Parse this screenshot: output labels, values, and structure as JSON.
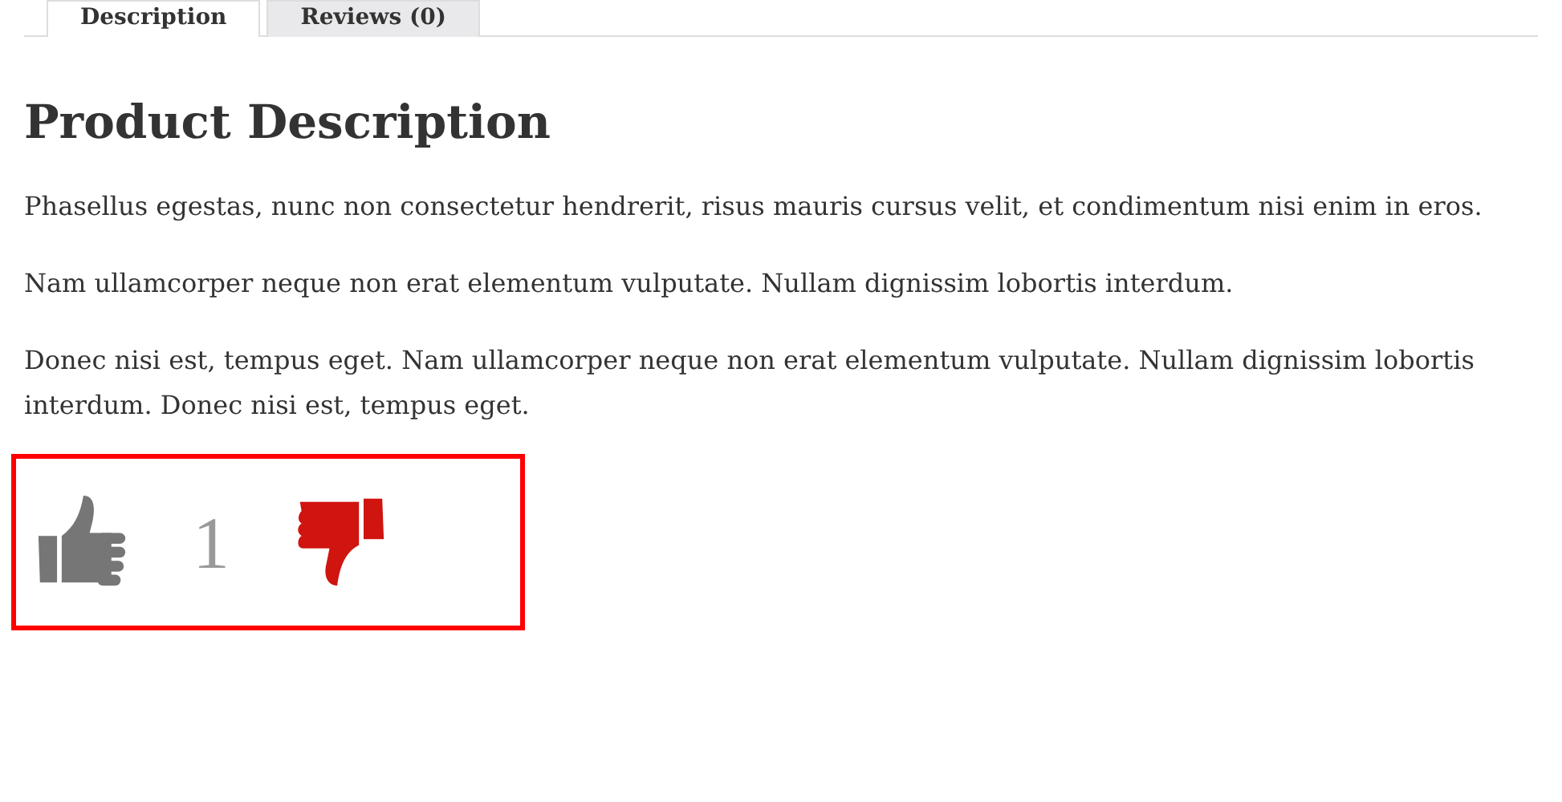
{
  "tabs": [
    {
      "label": "Description",
      "selected": true
    },
    {
      "label": "Reviews (0)",
      "selected": false
    }
  ],
  "heading": "Product Description",
  "paragraphs": [
    "Phasellus egestas, nunc non consectetur hendrerit, risus mauris cursus velit, et condimentum nisi enim in eros.",
    "Nam ullamcorper neque non erat elementum vulputate. Nullam dignissim lobortis interdum.",
    "Donec nisi est, tempus eget. Nam ullamcorper neque non erat elementum vulputate. Nullam dignissim lobortis interdum. Donec nisi est, tempus eget."
  ],
  "votes": {
    "highlighted": true,
    "like_selected": false,
    "count": "1",
    "dislike_selected": true
  }
}
